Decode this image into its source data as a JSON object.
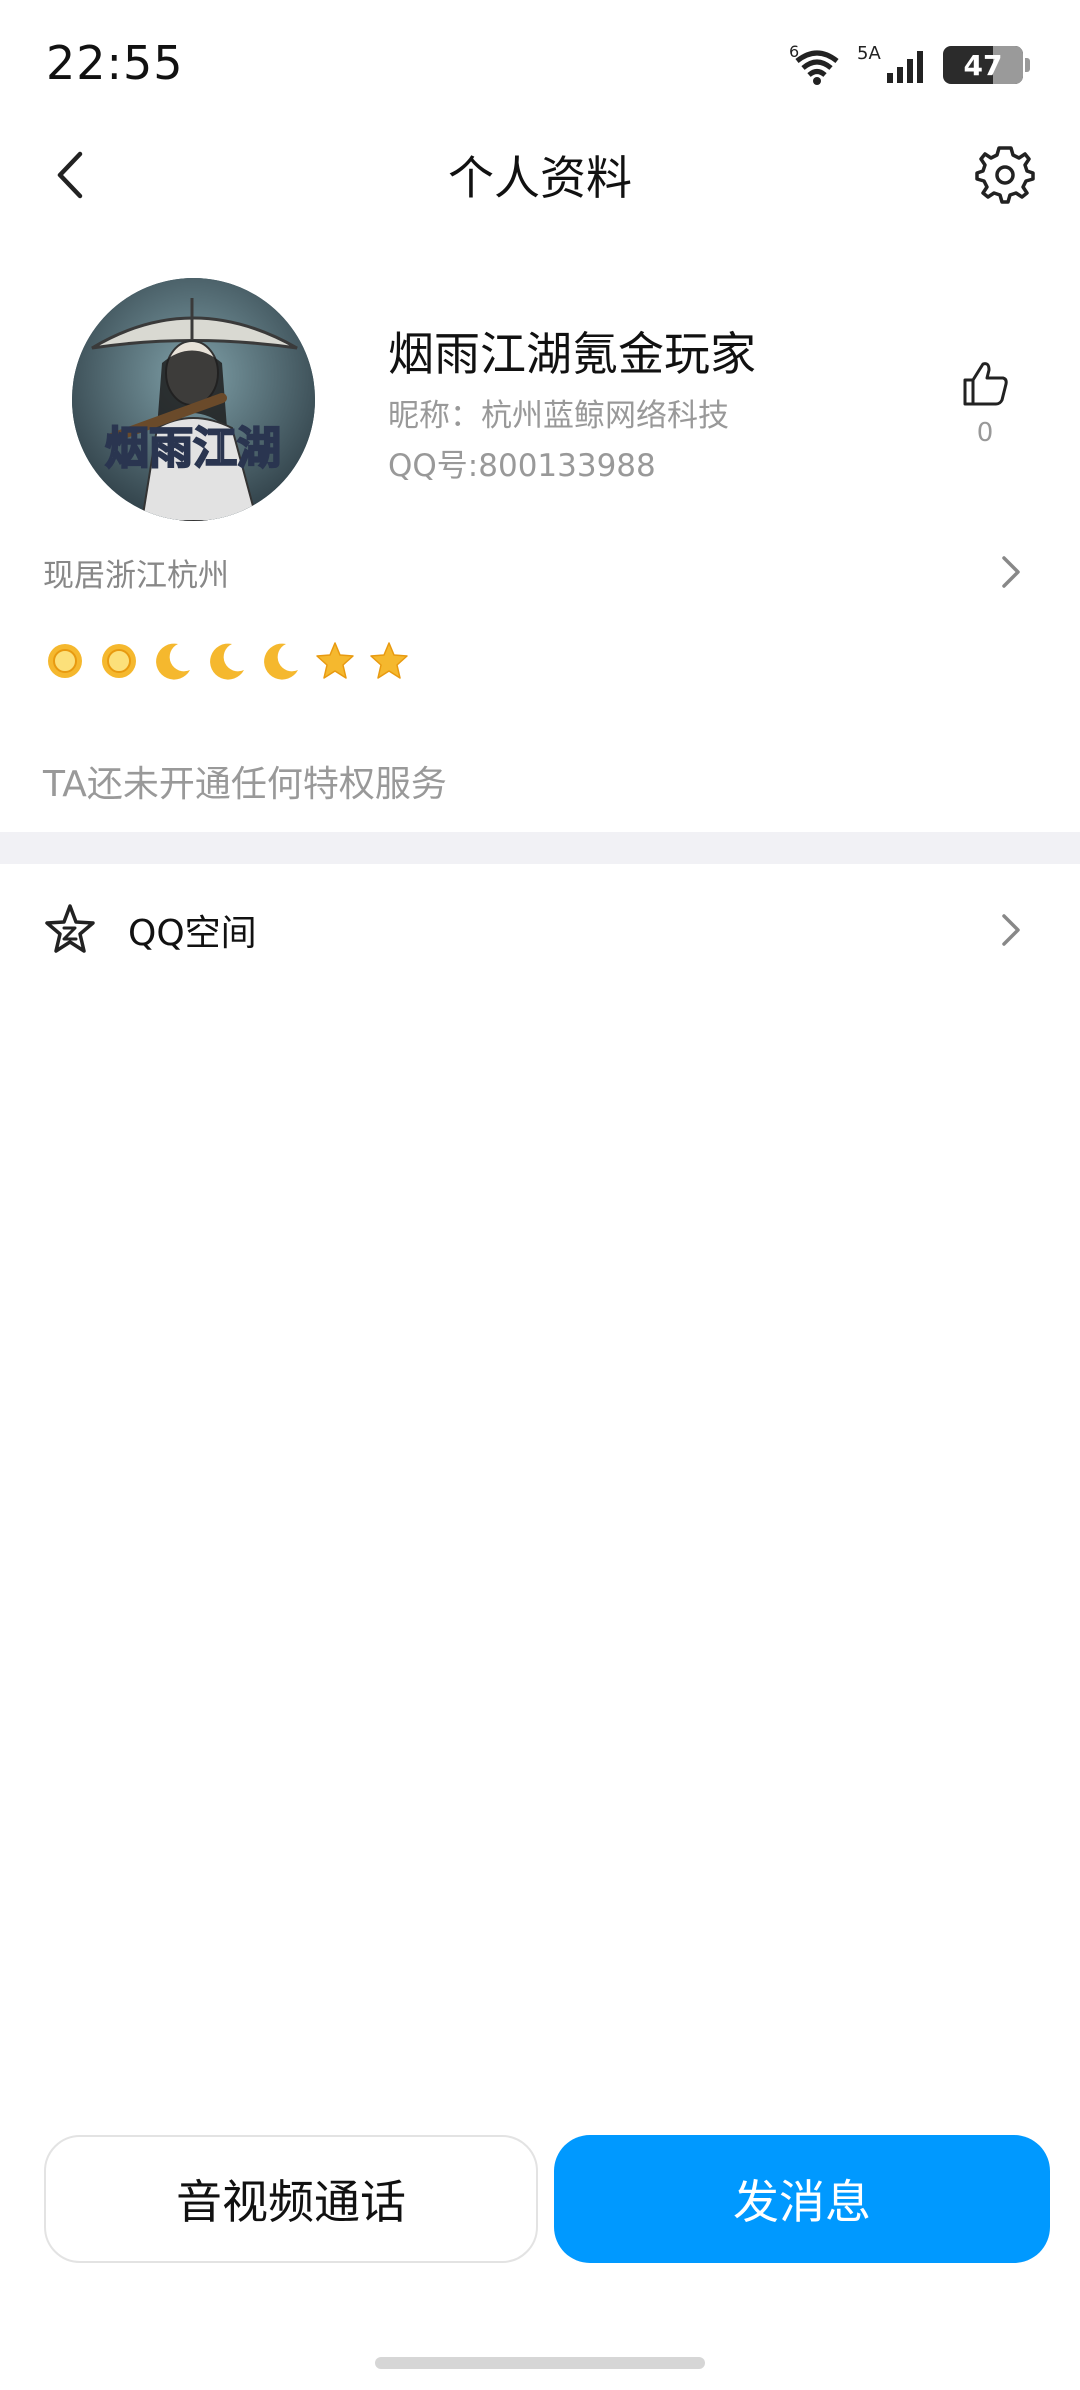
{
  "status_bar": {
    "time": "22:55",
    "battery": "47",
    "signal_label": "5A",
    "wifi_label": "6"
  },
  "nav": {
    "title": "个人资料",
    "back_icon": "chevron-left-icon",
    "settings_icon": "gear-icon"
  },
  "profile": {
    "avatar_text": "烟雨江湖",
    "name": "烟雨江湖氪金玩家",
    "nickname": "昵称：杭州蓝鲸网络科技",
    "qq_number": "QQ号:800133988",
    "likes": "0"
  },
  "location": {
    "text": "现居浙江杭州"
  },
  "level_badges": [
    "sun",
    "sun",
    "moon",
    "moon",
    "moon",
    "star",
    "star"
  ],
  "privilege": {
    "text": "TA还未开通任何特权服务"
  },
  "qzone": {
    "label": "QQ空间"
  },
  "actions": {
    "call_label": "音视频通话",
    "message_label": "发消息"
  },
  "colors": {
    "accent": "#0099ff",
    "badge_gold": "#f5b82e",
    "divider": "#f1f1f5"
  }
}
